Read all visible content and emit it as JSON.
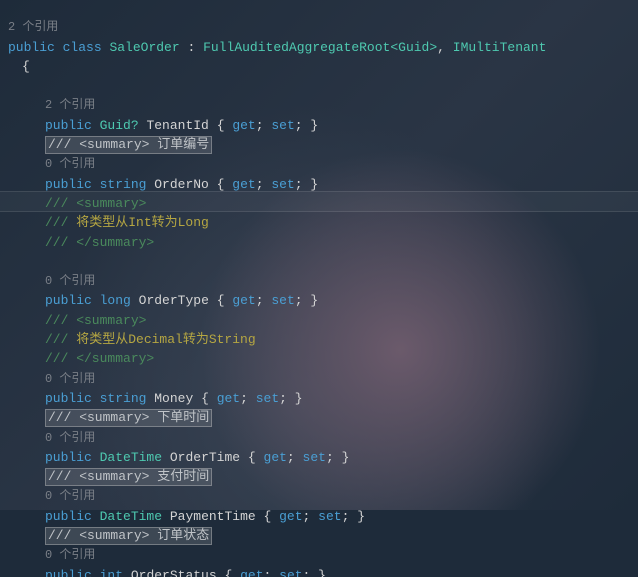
{
  "top_ref": "2 个引用",
  "decl": {
    "public": "public",
    "class": "class",
    "name": "SaleOrder",
    "colon": ":",
    "base": "FullAuditedAggregateRoot",
    "gen": "<Guid>",
    "comma": ",",
    "iface": "IMultiTenant"
  },
  "brace_open": "{",
  "refs": {
    "r2": "2 个引用",
    "r0": "0 个引用"
  },
  "prop": {
    "public": "public",
    "get": "get",
    "set": "set",
    "semi": ";",
    "ob": "{",
    "cb": "}",
    "p1": {
      "type": "Guid?",
      "name": "TenantId"
    },
    "p2": {
      "type": "string",
      "name": "OrderNo"
    },
    "p3": {
      "type": "long",
      "name": "OrderType"
    },
    "p4": {
      "type": "string",
      "name": "Money"
    },
    "p5": {
      "type": "DateTime",
      "name": "OrderTime"
    },
    "p6": {
      "type": "DateTime",
      "name": "PaymentTime"
    },
    "p7": {
      "type": "int",
      "name": "OrderStatus"
    }
  },
  "doc": {
    "s": "/// <summary>",
    "e": "/// </summary>",
    "box1": "/// <summary> 订单编号",
    "l1": "/// 将类型从Int转为Long",
    "l2": "/// 将类型从Decimal转为String",
    "box2": "/// <summary> 下单时间",
    "box3": "/// <summary> 支付时间",
    "box4": "/// <summary> 订单状态"
  }
}
